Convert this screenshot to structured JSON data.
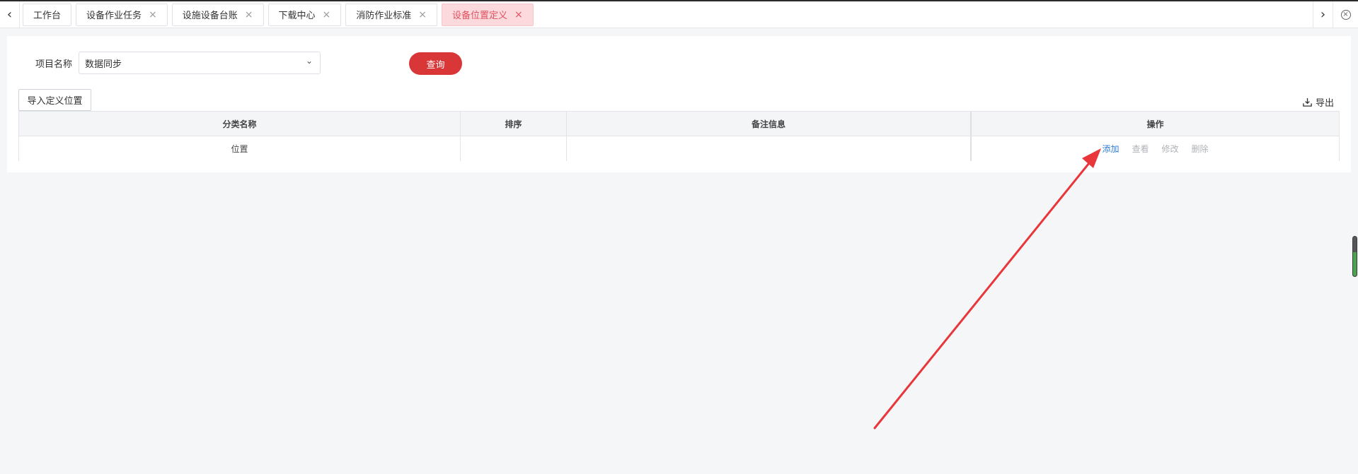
{
  "tabs": [
    {
      "label": "工作台",
      "closable": false,
      "active": false
    },
    {
      "label": "设备作业任务",
      "closable": true,
      "active": false
    },
    {
      "label": "设施设备台账",
      "closable": true,
      "active": false
    },
    {
      "label": "下载中心",
      "closable": true,
      "active": false
    },
    {
      "label": "消防作业标准",
      "closable": true,
      "active": false
    },
    {
      "label": "设备位置定义",
      "closable": true,
      "active": true
    }
  ],
  "filter": {
    "project_label": "项目名称",
    "project_value": "数据同步",
    "query_label": "查询"
  },
  "toolbar": {
    "import_label": "导入定义位置",
    "export_label": "导出"
  },
  "table": {
    "headers": [
      "分类名称",
      "排序",
      "备注信息",
      "操作"
    ],
    "rows": [
      {
        "name": "位置",
        "order": "",
        "remark": ""
      }
    ],
    "actions": {
      "add": "添加",
      "view": "查看",
      "edit": "修改",
      "delete": "删除"
    }
  },
  "icons": {
    "tab_prev": "chevron-left-icon",
    "tab_next": "chevron-right-icon",
    "tab_close": "close-icon",
    "close_all": "circle-close-icon",
    "select_chevron": "chevron-down-icon",
    "export": "download-icon"
  },
  "colors": {
    "accent": "#d93638",
    "active_tab_bg": "#fbd9dc",
    "active_tab_text": "#e0525f",
    "link": "#2d7bd8",
    "annotation_arrow": "#e8363a"
  }
}
